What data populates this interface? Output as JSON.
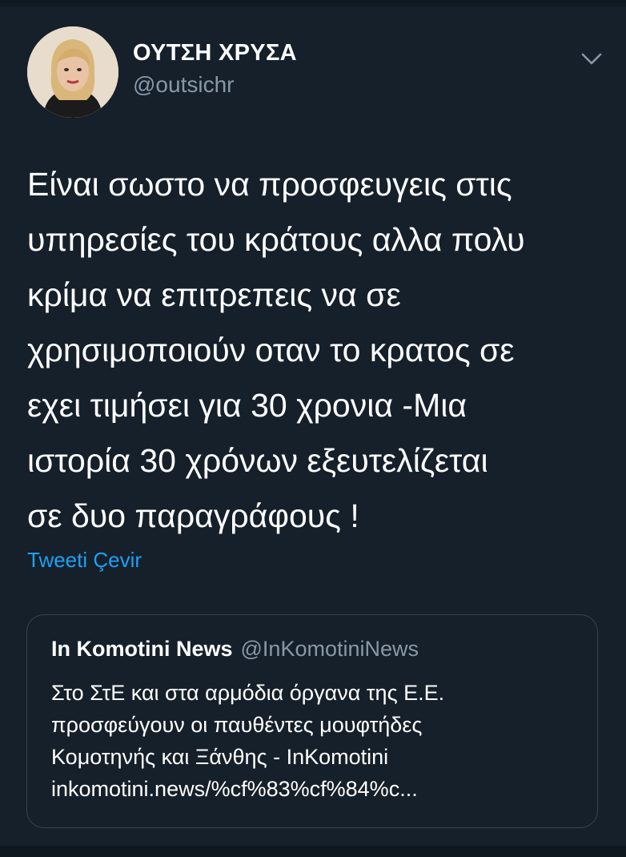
{
  "tweet": {
    "display_name": "ΟΥΤΣΗ ΧΡΥΣΑ",
    "handle": "@outsichr",
    "text_lines": [
      "Είναι σωστο να προσφευγεις στις",
      "υπηρεσίες του κράτους αλλα πολυ",
      "κρίμα να επιτρεπεις να σε",
      "χρησιμοποιούν οταν το κρατος σε",
      "εχει τιμήσει για 30 χρονια -Μια",
      "ιστορία 30 χρόνων εξευτελίζεται",
      "σε δυο παραγράφους !"
    ],
    "translate_label": "Tweeti Çevir"
  },
  "quote": {
    "name": "In Komotini News",
    "handle": "@InKomotiniNews",
    "text_lines": [
      "Στο ΣτΕ και στα αρμόδια όργανα της Ε.Ε.",
      "προσφεύγουν οι παυθέντες μουφτήδες",
      "Κομοτηνής και Ξάνθης - InKomotini",
      "inkomotini.news/%cf%83%cf%84%c..."
    ]
  },
  "icons": {
    "menu": "chevron-down-icon"
  },
  "colors": {
    "background": "#15202b",
    "link": "#1da1f2",
    "secondary_text": "#8899a6",
    "border": "#38444d"
  }
}
